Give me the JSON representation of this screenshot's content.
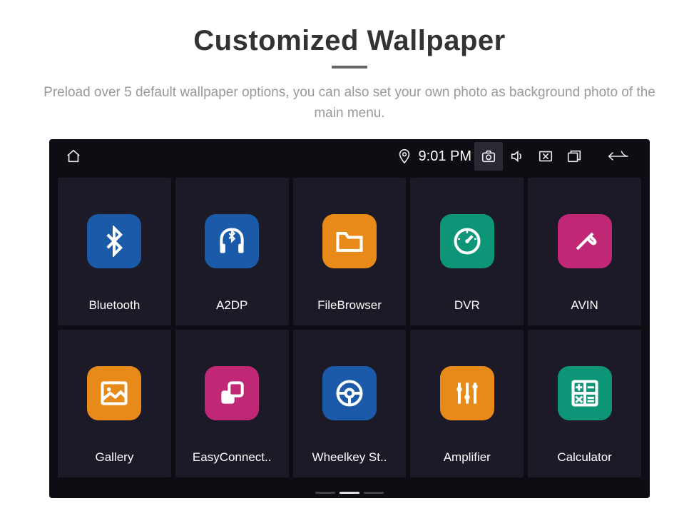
{
  "header": {
    "title": "Customized Wallpaper",
    "description": "Preload over 5 default wallpaper options, you can also set your own photo as background photo of the main menu."
  },
  "statusbar": {
    "time": "9:01 PM"
  },
  "apps": [
    {
      "label": "Bluetooth",
      "color": "c-blue"
    },
    {
      "label": "A2DP",
      "color": "c-blue"
    },
    {
      "label": "FileBrowser",
      "color": "c-orange"
    },
    {
      "label": "DVR",
      "color": "c-teal"
    },
    {
      "label": "AVIN",
      "color": "c-magenta"
    },
    {
      "label": "Gallery",
      "color": "c-orange"
    },
    {
      "label": "EasyConnect..",
      "color": "c-magenta"
    },
    {
      "label": "Wheelkey St..",
      "color": "c-blue"
    },
    {
      "label": "Amplifier",
      "color": "c-orange"
    },
    {
      "label": "Calculator",
      "color": "c-teal"
    }
  ]
}
